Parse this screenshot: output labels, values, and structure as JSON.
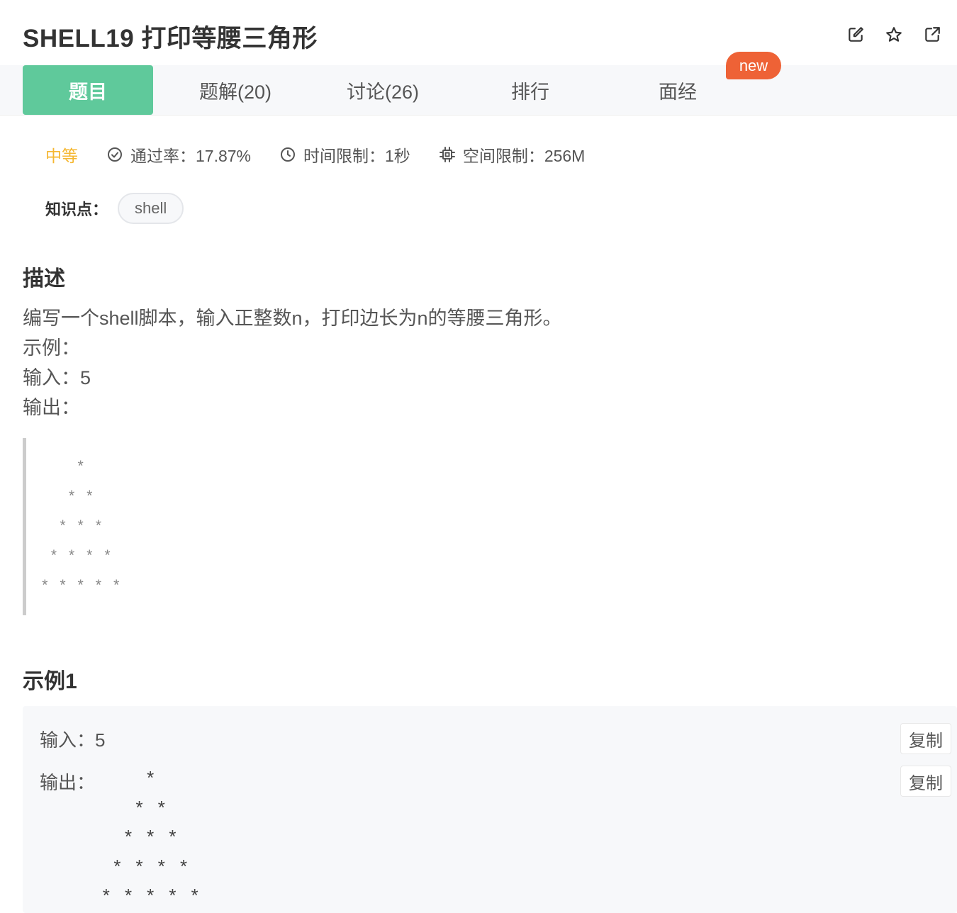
{
  "header": {
    "title": "SHELL19  打印等腰三角形",
    "icons": [
      "edit-icon",
      "star-icon",
      "share-icon"
    ]
  },
  "tabs": [
    {
      "label": "题目",
      "active": true
    },
    {
      "label": "题解(20)",
      "active": false
    },
    {
      "label": "讨论(26)",
      "active": false
    },
    {
      "label": "排行",
      "active": false
    },
    {
      "label": "面经",
      "active": false
    }
  ],
  "new_badge": "new",
  "meta": {
    "difficulty": "中等",
    "pass_rate": "通过率：17.87%",
    "time_limit": "时间限制：1秒",
    "space_limit": "空间限制：256M"
  },
  "knowledge": {
    "label": "知识点：",
    "tags": [
      "shell"
    ]
  },
  "description": {
    "title": "描述",
    "lines": [
      "编写一个shell脚本，输入正整数n，打印边长为n的等腰三角形。",
      "示例：",
      "输入：5",
      "输出："
    ],
    "quote": "    *\n   * *\n  * * *\n * * * *\n* * * * *"
  },
  "example1": {
    "title": "示例1",
    "input_label": "输入：",
    "input_value": "5",
    "output_label": "输出：",
    "output_value": "    *\n   * *\n  * * *\n * * * *\n* * * * *",
    "copy_label": "复制"
  },
  "colors": {
    "accent": "#5fc99b",
    "badge": "#ee6236",
    "difficulty": "#f5b731"
  }
}
